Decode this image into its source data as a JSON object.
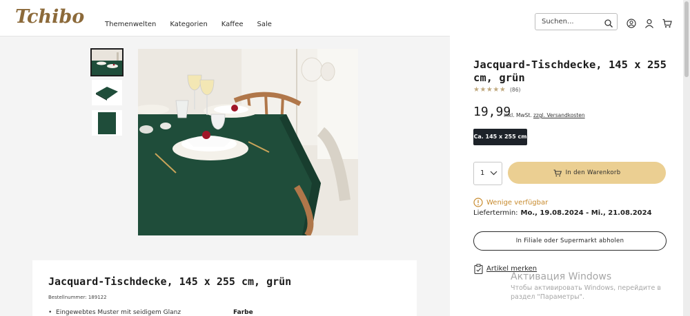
{
  "header": {
    "logo": "Tchibo",
    "nav": [
      "Themenwelten",
      "Kategorien",
      "Kaffee",
      "Sale"
    ],
    "search_placeholder": "Suchen..."
  },
  "product": {
    "title": "Jacquard-Tischdecke, 145 x 255 cm, grün",
    "rating_stars": "★★★★★",
    "rating": 4.5,
    "reviews": "(86)",
    "price": "19,99",
    "tax_note": "inkl. MwSt.",
    "shipping_link": "zzgl. Versandkosten",
    "variant": "Ca. 145 x 255 cm",
    "quantity": "1",
    "add_to_cart": "In den Warenkorb",
    "availability": "Wenige verfügbar",
    "delivery_label": "Liefertermin:",
    "delivery_dates": "Mo., 19.08.2024 - Mi., 21.08.2024",
    "store_pickup": "In Filiale oder Supermarkt abholen",
    "save_article": "Artikel merken"
  },
  "details": {
    "title": "Jacquard-Tischdecke, 145 x 255 cm, grün",
    "order_number": "Bestellnummer: 189122",
    "bullet": "Eingewebtes Muster mit seidigem Glanz",
    "color_heading": "Farbe"
  },
  "watermark": {
    "title": "Активация Windows",
    "text": "Чтобы активировать Windows, перейдите в раздел \"Параметры\"."
  },
  "colors": {
    "accent_gold": "#ebcf92",
    "tablecloth_green": "#1f4d3a",
    "warning": "#c78a2d",
    "variant_bg": "#1d2229"
  }
}
